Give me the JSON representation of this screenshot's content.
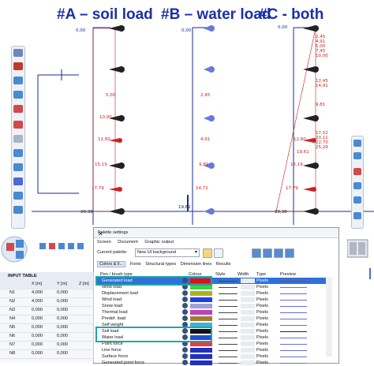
{
  "headings": {
    "a": "#A – soil load",
    "b": "#B – water load",
    "c": "#C - both"
  },
  "load_values": {
    "a": [
      "0,00",
      "5,00",
      "10,00",
      "12,60",
      "15,19",
      "17,79"
    ],
    "a_base": "20,38",
    "b": [
      "0,00",
      "2,45",
      "4,91",
      "9,81",
      "14,71"
    ],
    "b_base": "19,62",
    "c": [
      "0,00",
      "2,45",
      "4,91",
      "5,00",
      "7,45",
      "10,00",
      "12,45",
      "14,91",
      "9,81",
      "12,60",
      "17,52",
      "20,11",
      "22,70",
      "25,29",
      "19,61",
      "15,19",
      "17,79"
    ],
    "c_base": "20,38"
  },
  "dialog": {
    "title": "Palette settings",
    "close": "✕",
    "tabs": [
      "Screen",
      "Document",
      "Graphic output"
    ],
    "current_palette_label": "Current palette:",
    "current_palette_value": "New UI background",
    "subtabs": [
      "Colors & ll...",
      "Fonts",
      "Structural types",
      "Dimension lines",
      "Results"
    ],
    "columns": [
      "Pen / brush type",
      "Colour",
      "Style",
      "Width",
      "Type",
      "Preview"
    ],
    "rows": [
      {
        "name": "Generated load",
        "color": "#e01010",
        "type": "Pixels",
        "preview": "#cc2a2a",
        "selected": true
      },
      {
        "name": "Wind load",
        "color": "#40d040",
        "type": "Pixels",
        "preview": "#6a6ad8",
        "selected": false
      },
      {
        "name": "Displacement load",
        "color": "#b0b020",
        "type": "Pixels",
        "preview": "#6a6ad8",
        "selected": false
      },
      {
        "name": "Wind load",
        "color": "#2040e0",
        "type": "Pixels",
        "preview": "#6a6ad8",
        "selected": false
      },
      {
        "name": "Snow load",
        "color": "#a0a0d8",
        "type": "Pixels",
        "preview": "#6a6ad8",
        "selected": false
      },
      {
        "name": "Thermal load",
        "color": "#c040c0",
        "type": "Pixels",
        "preview": "#6a6ad8",
        "selected": false
      },
      {
        "name": "Predef. load",
        "color": "#a08030",
        "type": "Pixels",
        "preview": "#6a6ad8",
        "selected": false
      },
      {
        "name": "Self weight",
        "color": "#40b0e0",
        "type": "Pixels",
        "preview": "#6a6ad8",
        "selected": false
      },
      {
        "name": "Soil load",
        "color": "#111111",
        "type": "Pixels",
        "preview": "#222222",
        "selected": false
      },
      {
        "name": "Water load",
        "color": "#2050d0",
        "type": "Pixels",
        "preview": "#6a6ad8",
        "selected": false
      },
      {
        "name": "Point force",
        "color": "#e04040",
        "type": "Pixels",
        "preview": "#6a6ad8",
        "selected": false
      },
      {
        "name": "Line force",
        "color": "#2030c0",
        "type": "Pixels",
        "preview": "#6a6ad8",
        "selected": false
      },
      {
        "name": "Surface force",
        "color": "#2030c0",
        "type": "Pixels",
        "preview": "#6a6ad8",
        "selected": false
      },
      {
        "name": "Generated point force",
        "color": "#2030c0",
        "type": "Pixels",
        "preview": "#6a6ad8",
        "selected": false
      }
    ]
  },
  "input_table": {
    "title": "INPUT TABLE",
    "columns": [
      "",
      "X [m]",
      "Y [m]",
      "Z [m]"
    ],
    "rows": [
      [
        "N1",
        "4,000",
        "0,000",
        ""
      ],
      [
        "N2",
        "4,000",
        "0,000",
        ""
      ],
      [
        "N3",
        "0,000",
        "0,000",
        ""
      ],
      [
        "N4",
        "0,000",
        "0,000",
        ""
      ],
      [
        "N5",
        "0,000",
        "0,000",
        ""
      ],
      [
        "N6",
        "0,000",
        "0,000",
        ""
      ],
      [
        "N7",
        "0,000",
        "0,000",
        ""
      ],
      [
        "N8",
        "0,000",
        "0,000",
        ""
      ]
    ]
  }
}
